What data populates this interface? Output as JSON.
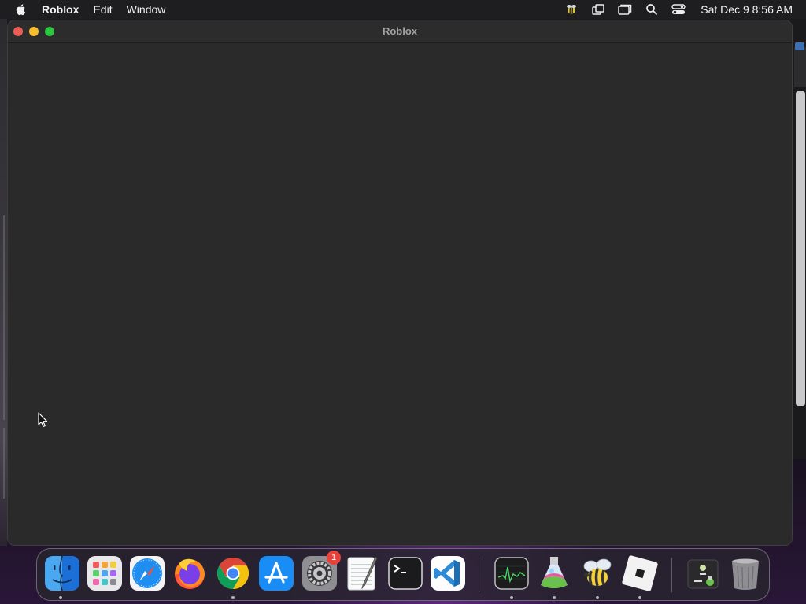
{
  "menubar": {
    "app_name": "Roblox",
    "menus": [
      "Edit",
      "Window"
    ],
    "status_icons": [
      "bee-status-icon",
      "layers-icon",
      "screen-mirroring-icon",
      "spotlight-search-icon",
      "control-center-icon"
    ],
    "clock": "Sat Dec 9  8:56 AM"
  },
  "window": {
    "title": "Roblox"
  },
  "dock": {
    "apps": [
      {
        "name": "Finder",
        "icon": "finder-icon",
        "running": true
      },
      {
        "name": "Launchpad",
        "icon": "launchpad-icon",
        "running": false
      },
      {
        "name": "Safari",
        "icon": "safari-icon",
        "running": false
      },
      {
        "name": "Firefox",
        "icon": "firefox-icon",
        "running": false
      },
      {
        "name": "Chrome",
        "icon": "chrome-icon",
        "running": true
      },
      {
        "name": "App Store",
        "icon": "app-store-icon",
        "running": false
      },
      {
        "name": "System Settings",
        "icon": "system-settings-icon",
        "running": false,
        "badge": "1"
      },
      {
        "name": "TextEdit",
        "icon": "textedit-icon",
        "running": false
      },
      {
        "name": "Terminal",
        "icon": "terminal-icon",
        "running": false
      },
      {
        "name": "Visual Studio Code",
        "icon": "vscode-icon",
        "running": false
      },
      {
        "name": "Activity Monitor",
        "icon": "activity-monitor-icon",
        "running": true
      },
      {
        "name": "Flask App",
        "icon": "flask-icon",
        "running": true
      },
      {
        "name": "Bee App",
        "icon": "bee-icon",
        "running": true
      },
      {
        "name": "Roblox",
        "icon": "roblox-icon",
        "running": true
      },
      {
        "name": "Downloads Folder",
        "icon": "downloads-stack-icon",
        "running": false
      },
      {
        "name": "Trash",
        "icon": "trash-icon",
        "running": false
      }
    ]
  }
}
